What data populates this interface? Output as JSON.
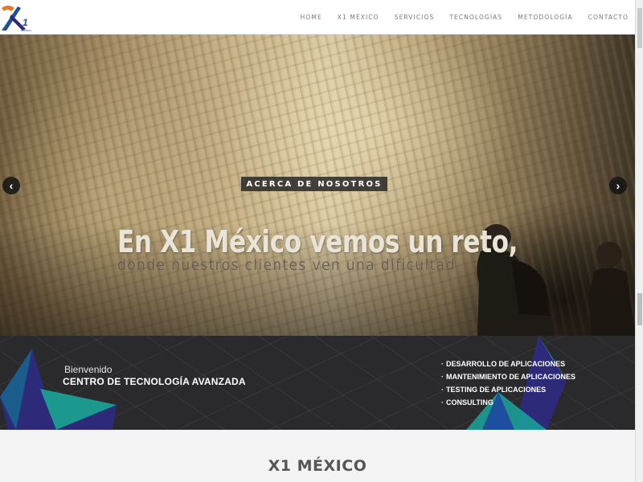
{
  "header": {
    "logo_text": "X1",
    "logo_subtext": "México",
    "nav": [
      {
        "label": "HOME"
      },
      {
        "label": "X1 MÉXICO"
      },
      {
        "label": "SERVICIOS"
      },
      {
        "label": "TECNOLOGÍAS"
      },
      {
        "label": "METODOLOGÍA"
      },
      {
        "label": "CONTACTO"
      }
    ]
  },
  "hero": {
    "button_label": "ACERCA DE NOSOTROS",
    "prev_arrow": "‹",
    "next_arrow": "›",
    "title": "En X1 México vemos un reto,",
    "subtitle": "donde nuestros clientes ven una dificultad"
  },
  "band": {
    "welcome": "Bienvenido",
    "center_title": "CENTRO DE TECNOLOGÍA AVANZADA",
    "services": [
      "DESARROLLO DE APLICACIONES",
      "MANTENIMIENTO DE APLICACIONES",
      "TESTING DE APLICACIONES",
      "CONSULTING"
    ]
  },
  "section": {
    "title": "X1 MÉXICO"
  },
  "colors": {
    "band_bg": "#2a2a2c",
    "teal": "#1aa59a",
    "indigo": "#2d2a7a",
    "orange": "#e4782a",
    "blue": "#1d4f9e"
  }
}
